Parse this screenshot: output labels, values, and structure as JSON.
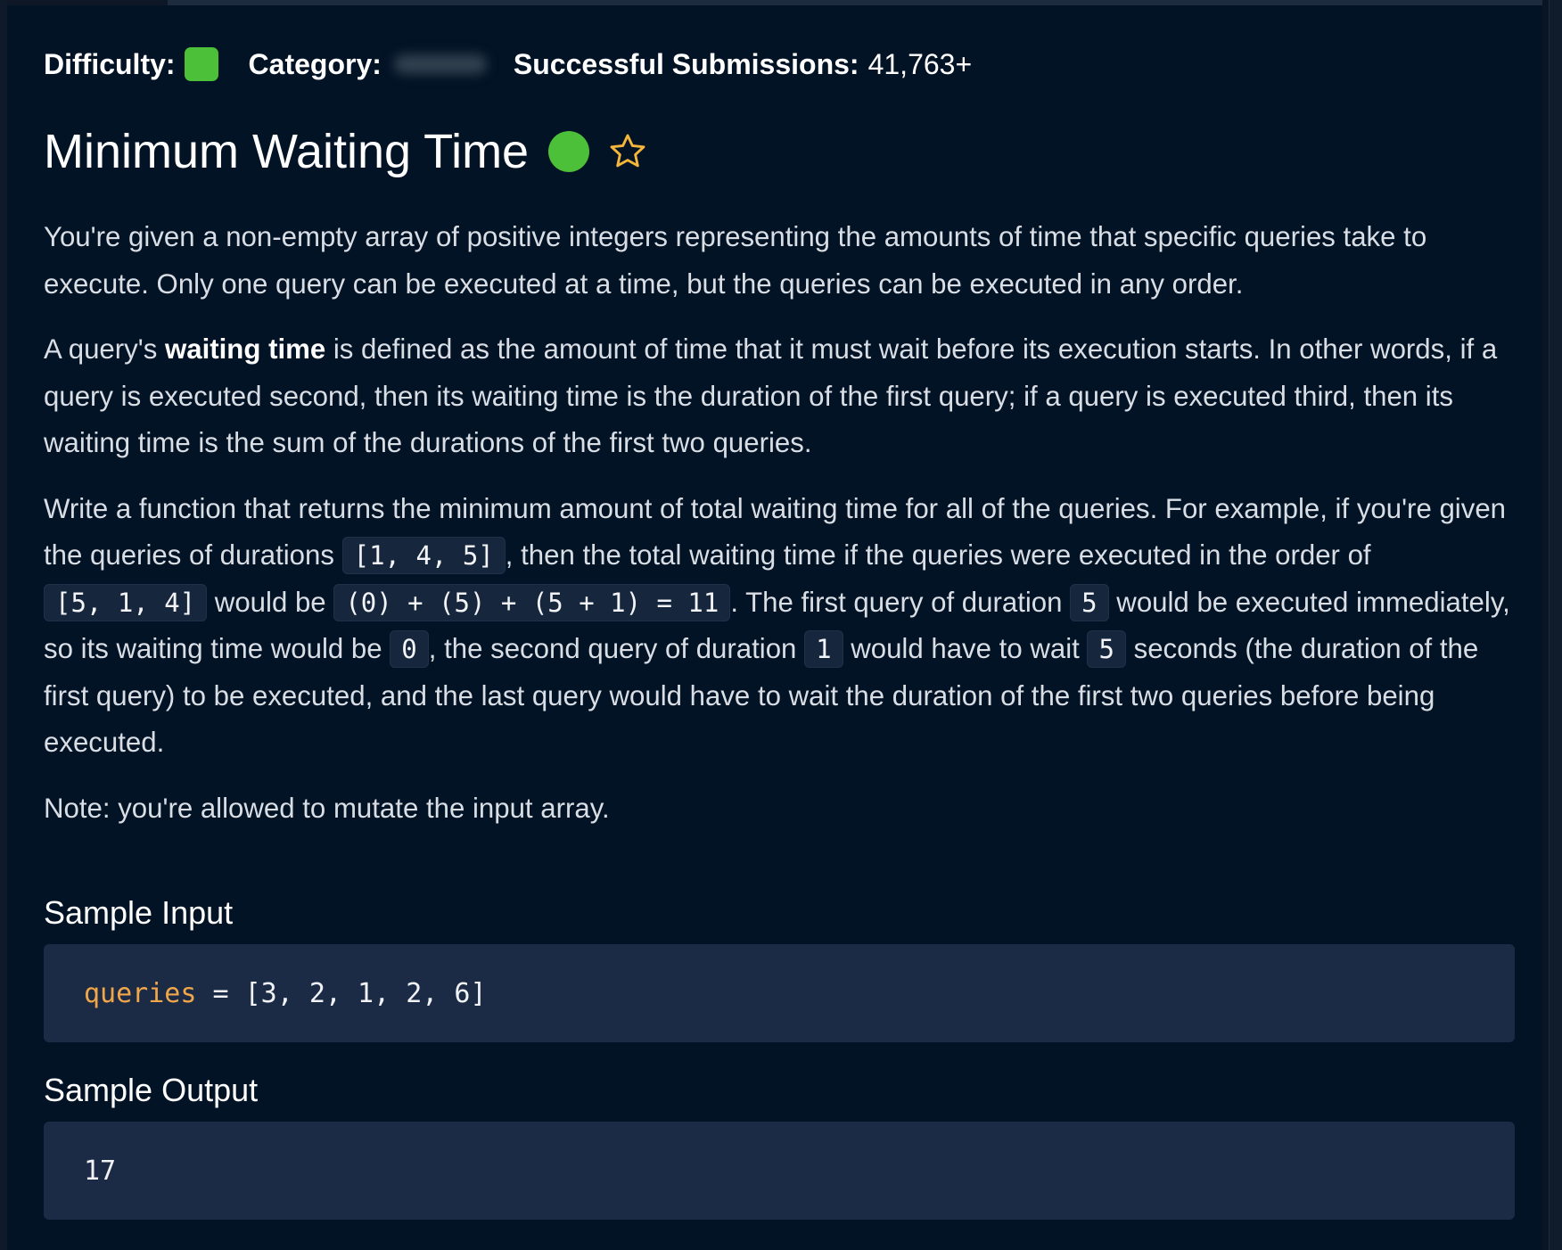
{
  "meta": {
    "difficulty_label": "Difficulty:",
    "difficulty_color": "#4cc038",
    "category_label": "Category:",
    "category_value_hidden": true,
    "submissions_label": "Successful Submissions:",
    "submissions_value": "41,763+"
  },
  "problem": {
    "title": "Minimum Waiting Time",
    "status_color": "#4cc038",
    "favorite_icon": "star-outline-icon",
    "star_color": "#f5b73b"
  },
  "description": {
    "p1": "You're given a non-empty array of positive integers representing the amounts of time that specific queries take to execute. Only one query can be executed at a time, but the queries can be executed in any order.",
    "p2_before": "A query's ",
    "p2_bold": "waiting time",
    "p2_after": " is defined as the amount of time that it must wait before its execution starts. In other words, if a query is executed second, then its waiting time is the duration of the first query; if a query is executed third, then its waiting time is the sum of the durations of the first two queries.",
    "p3_t1": "Write a function that returns the minimum amount of total waiting time for all of the queries. For example, if you're given the queries of durations ",
    "p3_c1": "[1, 4, 5]",
    "p3_t2": ", then the total waiting time if the queries were executed in the order of ",
    "p3_c2": "[5, 1, 4]",
    "p3_t3": " would be ",
    "p3_c3": "(0) + (5) + (5 + 1) = 11",
    "p3_t4": ". The first query of duration ",
    "p3_c4": "5",
    "p3_t5": " would be executed immediately, so its waiting time would be ",
    "p3_c5": "0",
    "p3_t6": ", the second query of duration ",
    "p3_c6": "1",
    "p3_t7": " would have to wait ",
    "p3_c7": "5",
    "p3_t8": " seconds (the duration of the first query) to be executed, and the last query would have to wait the duration of the first two queries before being executed.",
    "p4": "Note: you're allowed to mutate the input array."
  },
  "sample_input": {
    "heading": "Sample Input",
    "var_name": "queries",
    "rest": " = [3, 2, 1, 2, 6]"
  },
  "sample_output": {
    "heading": "Sample Output",
    "value": "17"
  },
  "colors": {
    "background": "#031326",
    "code_block_bg": "#1b2b45",
    "keyword": "#f2a64a"
  }
}
